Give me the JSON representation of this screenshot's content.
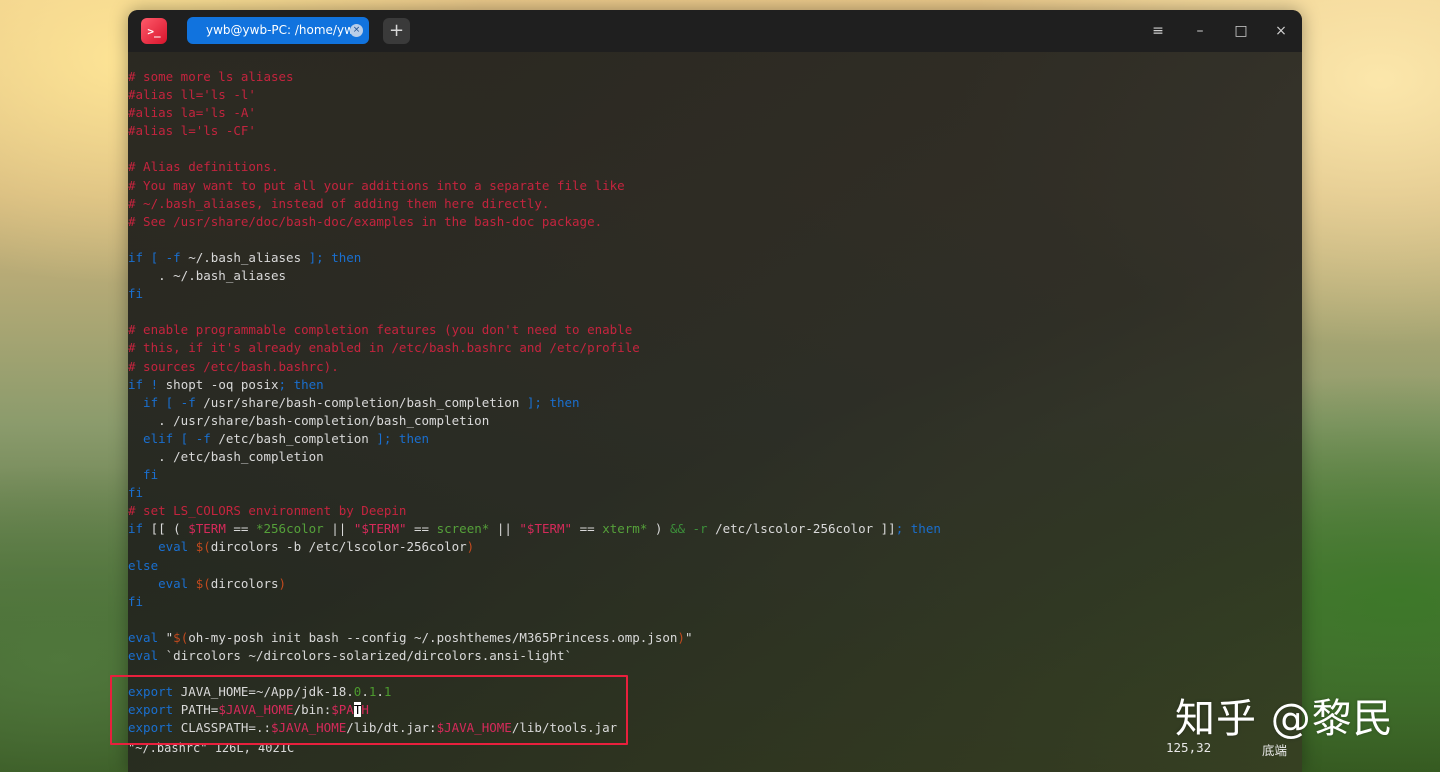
{
  "window": {
    "app_icon": ">_",
    "tab_title": "ywb@ywb-PC: /home/ywb",
    "tab_close": "×",
    "new_tab": "+",
    "menu_icon": "≡",
    "minimize_icon": "–",
    "maximize_icon": "□",
    "close_icon": "×"
  },
  "terminal": {
    "lines": [
      [
        [
          "c-com",
          "# some more ls aliases"
        ]
      ],
      [
        [
          "c-com",
          "#alias ll='ls -l'"
        ]
      ],
      [
        [
          "c-com",
          "#alias la='ls -A'"
        ]
      ],
      [
        [
          "c-com",
          "#alias l='ls -CF'"
        ]
      ],
      [],
      [
        [
          "c-com",
          "# Alias definitions."
        ]
      ],
      [
        [
          "c-com",
          "# You may want to put all your additions into a separate file like"
        ]
      ],
      [
        [
          "c-com",
          "# ~/.bash_aliases, instead of adding them here directly."
        ]
      ],
      [
        [
          "c-com",
          "# See /usr/share/doc/bash-doc/examples in the bash-doc package."
        ]
      ],
      [],
      [
        [
          "c-kw",
          "if [ -f "
        ],
        [
          "c-txt",
          "~/.bash_aliases "
        ],
        [
          "c-kw",
          "]; then"
        ]
      ],
      [
        [
          "c-txt",
          "    . ~/.bash_aliases"
        ]
      ],
      [
        [
          "c-kw",
          "fi"
        ]
      ],
      [],
      [
        [
          "c-com",
          "# enable programmable completion features (you don't need to enable"
        ]
      ],
      [
        [
          "c-com",
          "# this, if it's already enabled in /etc/bash.bashrc and /etc/profile"
        ]
      ],
      [
        [
          "c-com",
          "# sources /etc/bash.bashrc)."
        ]
      ],
      [
        [
          "c-kw",
          "if ! "
        ],
        [
          "c-txt",
          "shopt -oq posix"
        ],
        [
          "c-kw",
          "; then"
        ]
      ],
      [
        [
          "c-kw",
          "  if [ -f "
        ],
        [
          "c-txt",
          "/usr/share/bash-completion/bash_completion "
        ],
        [
          "c-kw",
          "]; then"
        ]
      ],
      [
        [
          "c-txt",
          "    . /usr/share/bash-completion/bash_completion"
        ]
      ],
      [
        [
          "c-kw",
          "  elif [ -f "
        ],
        [
          "c-txt",
          "/etc/bash_completion "
        ],
        [
          "c-kw",
          "]; then"
        ]
      ],
      [
        [
          "c-txt",
          "    . /etc/bash_completion"
        ]
      ],
      [
        [
          "c-kw",
          "  fi"
        ]
      ],
      [
        [
          "c-kw",
          "fi"
        ]
      ],
      [
        [
          "c-com",
          "# set LS_COLORS environment by Deepin"
        ]
      ],
      [
        [
          "c-kw",
          "if "
        ],
        [
          "c-txt",
          "[[ ( "
        ],
        [
          "c-var",
          "$TERM"
        ],
        [
          "c-txt",
          " == "
        ],
        [
          "c-str",
          "*256color"
        ],
        [
          "c-txt",
          " || "
        ],
        [
          "c-var",
          "\"$TERM\""
        ],
        [
          "c-txt",
          " == "
        ],
        [
          "c-str",
          "screen*"
        ],
        [
          "c-txt",
          " || "
        ],
        [
          "c-var",
          "\"$TERM\""
        ],
        [
          "c-txt",
          " == "
        ],
        [
          "c-str",
          "xterm*"
        ],
        [
          "c-txt",
          " ) "
        ],
        [
          "c-op",
          "&& -r "
        ],
        [
          "c-txt",
          "/etc/lscolor-256color ]]"
        ],
        [
          "c-kw",
          "; then"
        ]
      ],
      [
        [
          "c-kw",
          "    eval "
        ],
        [
          "c-par",
          "$("
        ],
        [
          "c-txt",
          "dircolors -b /etc/lscolor-256color"
        ],
        [
          "c-par",
          ")"
        ]
      ],
      [
        [
          "c-kw",
          "else"
        ]
      ],
      [
        [
          "c-kw",
          "    eval "
        ],
        [
          "c-par",
          "$("
        ],
        [
          "c-txt",
          "dircolors"
        ],
        [
          "c-par",
          ")"
        ]
      ],
      [
        [
          "c-kw",
          "fi"
        ]
      ],
      [],
      [
        [
          "c-kw",
          "eval "
        ],
        [
          "c-txt",
          "\""
        ],
        [
          "c-par",
          "$("
        ],
        [
          "c-txt",
          "oh-my-posh init bash --config ~/.poshthemes/M365Princess.omp.json"
        ],
        [
          "c-par",
          ")"
        ],
        [
          "c-txt",
          "\""
        ]
      ],
      [
        [
          "c-kw",
          "eval "
        ],
        [
          "c-txt",
          "`dircolors ~/dircolors-solarized/dircolors.ansi-light`"
        ]
      ],
      [],
      [
        [
          "c-kw",
          "export "
        ],
        [
          "c-txt",
          "JAVA_HOME=~/App/jdk-18."
        ],
        [
          "c-num",
          "0"
        ],
        [
          "c-txt",
          "."
        ],
        [
          "c-num",
          "1"
        ],
        [
          "c-txt",
          "."
        ],
        [
          "c-num",
          "1"
        ]
      ],
      [
        [
          "c-kw",
          "export "
        ],
        [
          "c-txt",
          "PATH="
        ],
        [
          "c-var",
          "$JAVA_HOME"
        ],
        [
          "c-txt",
          "/bin:"
        ],
        [
          "c-var",
          "$PA"
        ],
        [
          "cursor",
          "T"
        ],
        [
          "c-var",
          "H"
        ]
      ],
      [
        [
          "c-kw",
          "export "
        ],
        [
          "c-txt",
          "CLASSPATH=.:"
        ],
        [
          "c-var",
          "$JAVA_HOME"
        ],
        [
          "c-txt",
          "/lib/dt.jar:"
        ],
        [
          "c-var",
          "$JAVA_HOME"
        ],
        [
          "c-txt",
          "/lib/tools.jar"
        ]
      ]
    ],
    "status_line": "\"~/.bashrc\" 126L, 4021C"
  },
  "overlay": {
    "cursor_pos": "125,32",
    "position_label": "底端",
    "watermark": "知乎 @黎民"
  },
  "colors": {
    "accent": "#1173de",
    "highlight_box": "#e8203d",
    "comment": "#c4243e",
    "keyword": "#1a6fcf"
  }
}
